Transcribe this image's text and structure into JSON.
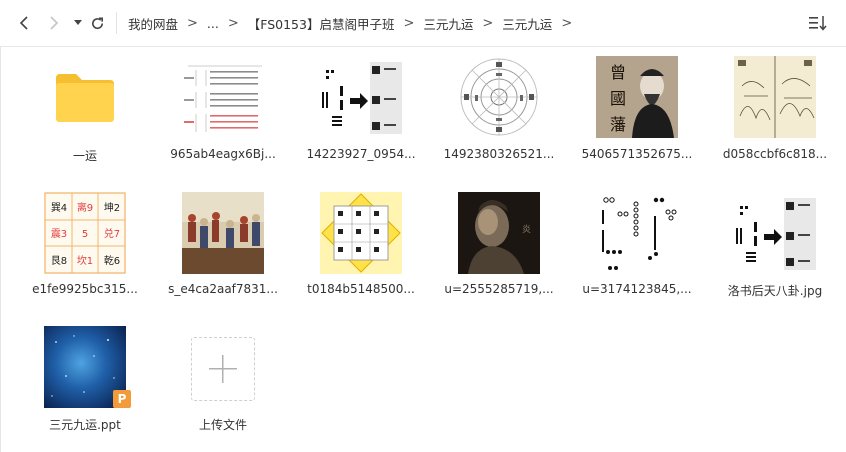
{
  "toolbar": {
    "back_icon": "chevron-left-icon",
    "forward_icon": "chevron-right-icon",
    "history_icon": "caret-down-icon",
    "refresh_icon": "refresh-icon",
    "view_icon": "sort-list-icon"
  },
  "breadcrumb": {
    "items": [
      "我的网盘",
      "...",
      "【FS0153】启慧阁甲子班",
      "三元九运",
      "三元九运"
    ],
    "separator": ">"
  },
  "files": [
    {
      "name": "一运",
      "type": "folder"
    },
    {
      "name": "965ab4eagx6Bj...",
      "type": "image",
      "thumb": "table-chart"
    },
    {
      "name": "14223927_0954...",
      "type": "image",
      "thumb": "trigram-arrow"
    },
    {
      "name": "1492380326521...",
      "type": "image",
      "thumb": "compass"
    },
    {
      "name": "5406571352675...",
      "type": "image",
      "thumb": "portrait",
      "chars": "曾國藩"
    },
    {
      "name": "d058ccbf6c818...",
      "type": "image",
      "thumb": "ancient-drawing"
    },
    {
      "name": "e1fe9925bc315...",
      "type": "image",
      "thumb": "nine-grid",
      "grid": [
        [
          "巽4",
          "离9",
          "坤2"
        ],
        [
          "震3",
          "5",
          "兑7"
        ],
        [
          "艮8",
          "坎1",
          "乾6"
        ]
      ]
    },
    {
      "name": "s_e4ca2aaf7831...",
      "type": "image",
      "thumb": "painting"
    },
    {
      "name": "t0184b5148500...",
      "type": "image",
      "thumb": "yellow-diagram"
    },
    {
      "name": "u=2555285719,...",
      "type": "image",
      "thumb": "statue"
    },
    {
      "name": "u=3174123845,...",
      "type": "image",
      "thumb": "hetu"
    },
    {
      "name": "洛书后天八卦.jpg",
      "type": "image",
      "thumb": "trigram-arrow"
    },
    {
      "name": "三元九运.ppt",
      "type": "ppt",
      "badge": "P"
    },
    {
      "name": "上传文件",
      "type": "upload"
    }
  ],
  "colors": {
    "folder": "#ffd34d",
    "folder_back": "#f6bf2f",
    "ppt_badge": "#f29b38",
    "grid_border": "#f0b56a",
    "grid_red": "#e23b3b"
  }
}
